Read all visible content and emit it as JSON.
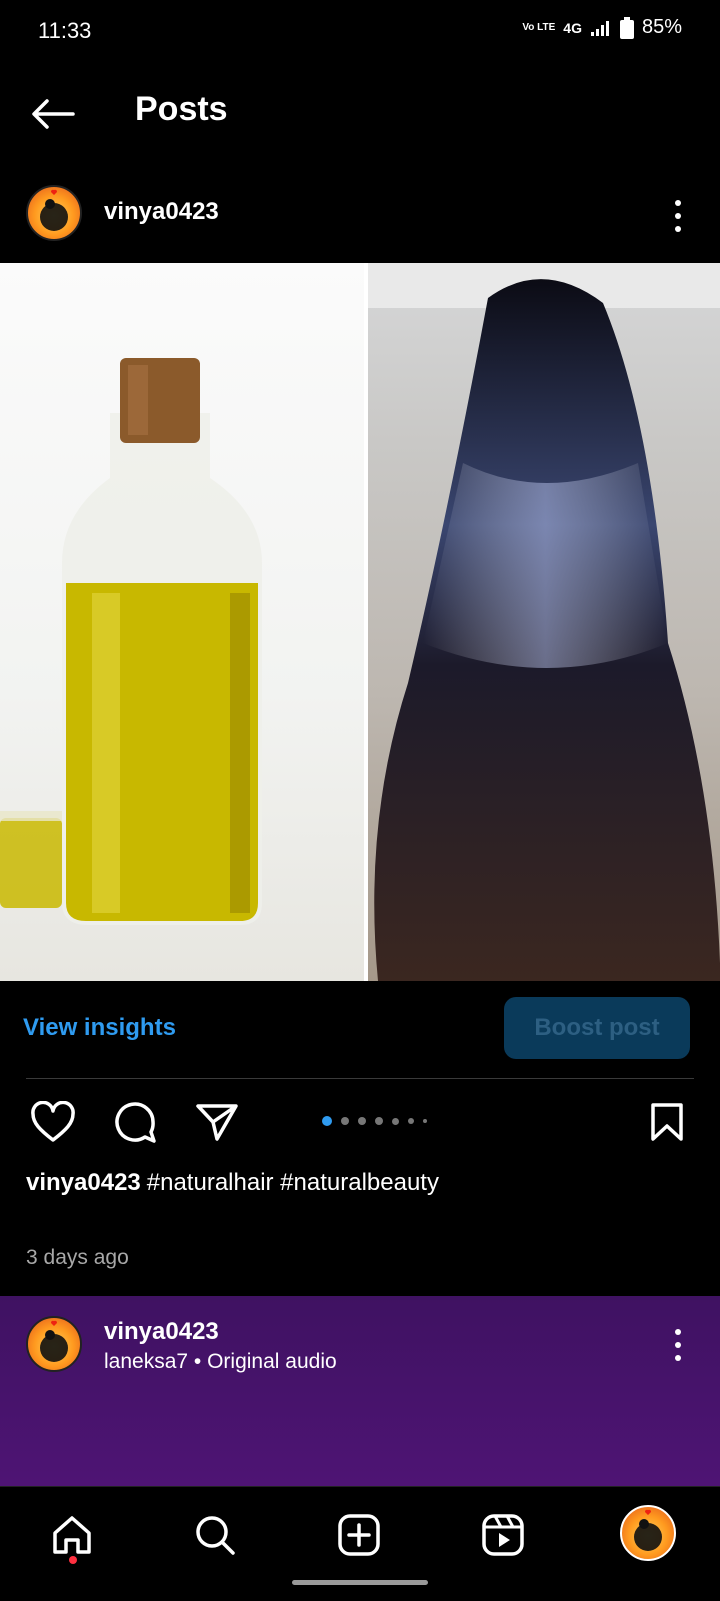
{
  "status_bar": {
    "time": "11:33",
    "volte": "Vo LTE",
    "network": "4G",
    "battery": "85%"
  },
  "header": {
    "title": "Posts",
    "back_icon": "arrow-left-icon"
  },
  "post": {
    "username": "vinya0423",
    "caption_user": "vinya0423",
    "caption_text": "#naturalhair #naturalbeauty",
    "timestamp": "3 days ago",
    "carousel_count": 7,
    "carousel_active": 1
  },
  "insights": {
    "view_label": "View insights",
    "boost_label": "Boost post"
  },
  "next_post": {
    "username": "vinya0423",
    "audio": "laneksa7 • Original audio"
  },
  "icons": {
    "like": "heart-icon",
    "comment": "comment-icon",
    "share": "send-icon",
    "save": "bookmark-icon",
    "more": "more-vertical-icon",
    "home": "home-icon",
    "search": "search-icon",
    "add": "add-post-icon",
    "reels": "reels-icon",
    "profile": "profile-avatar"
  },
  "colors": {
    "accent": "#2f9bf0",
    "boost_bg": "#0a3a5a",
    "next_post_bg": "#4a1470",
    "notification_dot": "#ff3040"
  }
}
